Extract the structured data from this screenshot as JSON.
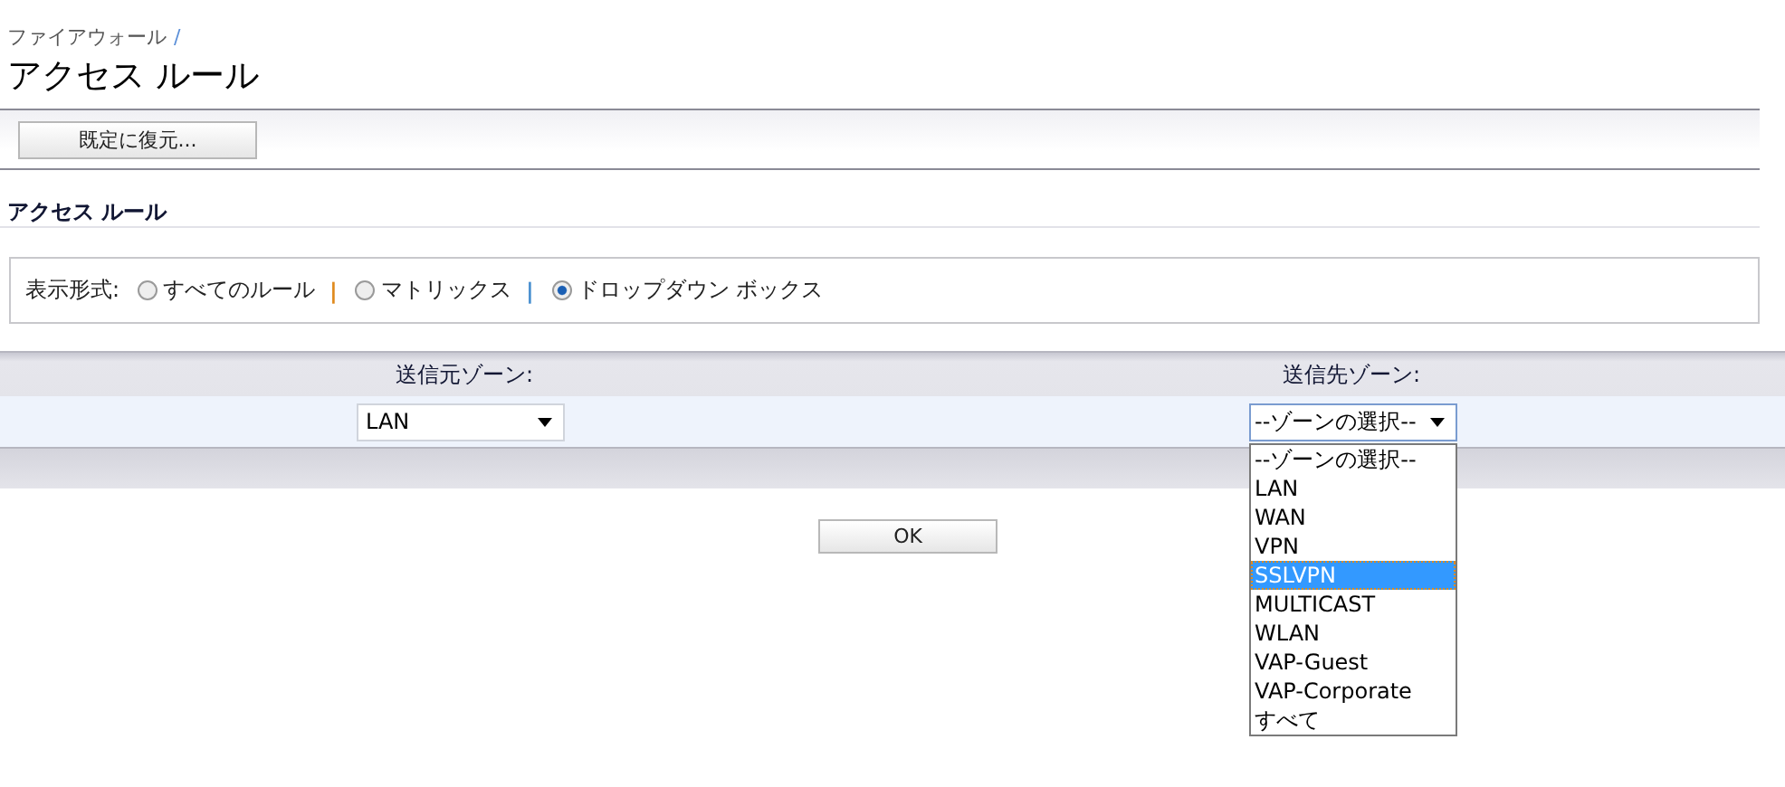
{
  "breadcrumb": {
    "label": "ファイアウォール",
    "separator": "/"
  },
  "title": "アクセス ルール",
  "toolbar": {
    "buttons": [
      "既定に復元..."
    ]
  },
  "section_title": "アクセス ルール",
  "view_format": {
    "label": "表示形式:",
    "options": [
      {
        "label": "すべてのルール",
        "selected": false,
        "separator": {
          "text": "|",
          "color": "#e08a1e"
        }
      },
      {
        "label": "マトリックス",
        "selected": false,
        "separator": {
          "text": "|",
          "color": "#4a90d0"
        }
      },
      {
        "label": "ドロップダウン ボックス",
        "selected": true
      }
    ]
  },
  "zones": {
    "source": {
      "label": "送信元ゾーン:",
      "value": "LAN"
    },
    "destination": {
      "label": "送信先ゾーン:",
      "value": "--ゾーンの選択--",
      "expanded": true,
      "options": [
        {
          "label": "--ゾーンの選択--",
          "highlighted": false
        },
        {
          "label": "LAN",
          "highlighted": false
        },
        {
          "label": "WAN",
          "highlighted": false
        },
        {
          "label": "VPN",
          "highlighted": false
        },
        {
          "label": "SSLVPN",
          "highlighted": true
        },
        {
          "label": "MULTICAST",
          "highlighted": false
        },
        {
          "label": "WLAN",
          "highlighted": false
        },
        {
          "label": "VAP-Guest",
          "highlighted": false
        },
        {
          "label": "VAP-Corporate",
          "highlighted": false
        },
        {
          "label": "すべて",
          "highlighted": false
        }
      ]
    }
  },
  "buttons": [
    "OK"
  ]
}
